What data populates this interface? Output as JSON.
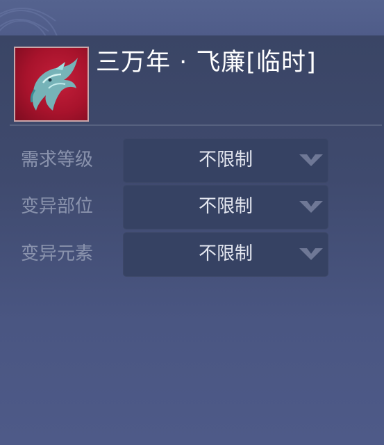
{
  "item": {
    "title": "三万年 · 飞廉[临时]",
    "icon": "eagle-head-icon",
    "icon_colors": {
      "background": "#b3162f",
      "feather": "#7fd0d0"
    }
  },
  "filters": [
    {
      "label": "需求等级",
      "value": "不限制"
    },
    {
      "label": "变异部位",
      "value": "不限制"
    },
    {
      "label": "变异元素",
      "value": "不限制"
    }
  ],
  "colors": {
    "panel": "#3c4769",
    "select": "#364263",
    "label": "#8a93ad",
    "value": "#e4e7f0",
    "title": "#ffffff"
  }
}
